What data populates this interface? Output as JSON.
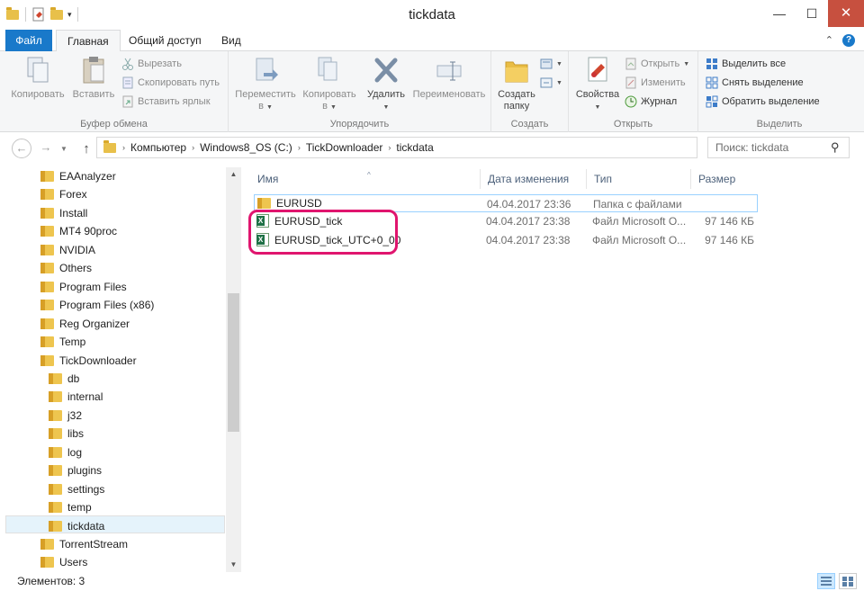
{
  "window": {
    "title": "tickdata",
    "minimize": "—",
    "maximize": "☐",
    "close": "✕"
  },
  "ribbon_tabs": {
    "file": "Файл",
    "home": "Главная",
    "share": "Общий доступ",
    "view": "Вид",
    "expand": "⌃",
    "help": "?"
  },
  "ribbon": {
    "clipboard": {
      "label": "Буфер обмена",
      "copy": "Копировать",
      "paste": "Вставить",
      "cut": "Вырезать",
      "copy_path": "Скопировать путь",
      "paste_shortcut": "Вставить ярлык"
    },
    "organize": {
      "label": "Упорядочить",
      "move_to": "Переместить",
      "move_to_2": "в",
      "copy_to": "Копировать",
      "copy_to_2": "в",
      "delete": "Удалить",
      "rename": "Переименовать"
    },
    "create": {
      "label": "Создать",
      "new_folder": "Создать",
      "new_folder_2": "папку"
    },
    "open": {
      "label": "Открыть",
      "properties": "Свойства",
      "open": "Открыть",
      "edit": "Изменить",
      "history": "Журнал"
    },
    "select": {
      "label": "Выделить",
      "select_all": "Выделить все",
      "select_none": "Снять выделение",
      "invert": "Обратить выделение"
    }
  },
  "address": {
    "crumbs": [
      "Компьютер",
      "Windows8_OS (C:)",
      "TickDownloader",
      "tickdata"
    ],
    "search_placeholder": "Поиск: tickdata"
  },
  "nav_tree": [
    {
      "label": "EAAnalyzer",
      "level": 1
    },
    {
      "label": "Forex",
      "level": 1
    },
    {
      "label": "Install",
      "level": 1
    },
    {
      "label": "MT4 90proc",
      "level": 1
    },
    {
      "label": "NVIDIA",
      "level": 1
    },
    {
      "label": "Others",
      "level": 1
    },
    {
      "label": "Program Files",
      "level": 1
    },
    {
      "label": "Program Files (x86)",
      "level": 1
    },
    {
      "label": "Reg Organizer",
      "level": 1
    },
    {
      "label": "Temp",
      "level": 1
    },
    {
      "label": "TickDownloader",
      "level": 1
    },
    {
      "label": "db",
      "level": 2
    },
    {
      "label": "internal",
      "level": 2
    },
    {
      "label": "j32",
      "level": 2
    },
    {
      "label": "libs",
      "level": 2
    },
    {
      "label": "log",
      "level": 2
    },
    {
      "label": "plugins",
      "level": 2
    },
    {
      "label": "settings",
      "level": 2
    },
    {
      "label": "temp",
      "level": 2
    },
    {
      "label": "tickdata",
      "level": 2,
      "selected": true
    },
    {
      "label": "TorrentStream",
      "level": 1
    },
    {
      "label": "Users",
      "level": 1
    }
  ],
  "columns": {
    "name": "Имя",
    "date": "Дата изменения",
    "type": "Тип",
    "size": "Размер"
  },
  "files": [
    {
      "name": "EURUSD",
      "date": "04.04.2017 23:36",
      "type": "Папка с файлами",
      "size": "",
      "kind": "folder"
    },
    {
      "name": "EURUSD_tick",
      "date": "04.04.2017 23:38",
      "type": "Файл Microsoft O...",
      "size": "97 146 КБ",
      "kind": "excel"
    },
    {
      "name": "EURUSD_tick_UTC+0_00",
      "date": "04.04.2017 23:38",
      "type": "Файл Microsoft O...",
      "size": "97 146 КБ",
      "kind": "excel"
    }
  ],
  "status": {
    "items": "Элементов: 3"
  },
  "colors": {
    "accent": "#1979ca",
    "highlight": "#e0156e",
    "selection": "#e5f3fb"
  }
}
